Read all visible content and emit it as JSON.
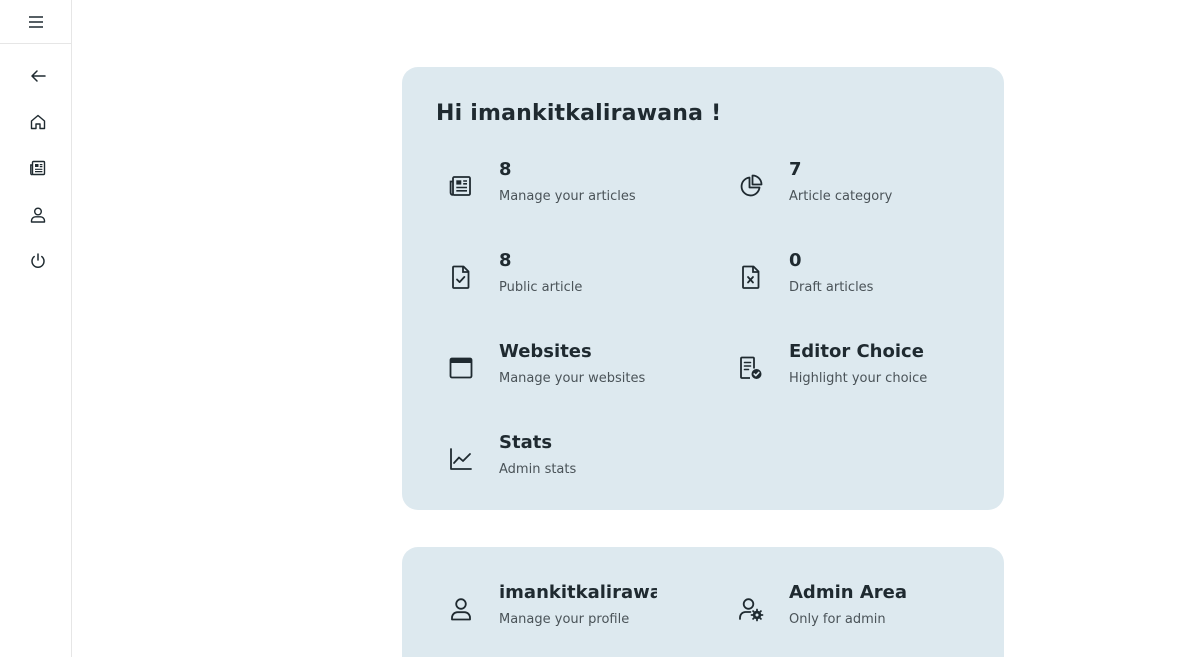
{
  "sidebar": {
    "menu_icon": "hamburger-icon",
    "items": [
      {
        "icon": "arrow-left-icon"
      },
      {
        "icon": "home-icon"
      },
      {
        "icon": "newspaper-icon"
      },
      {
        "icon": "user-icon"
      },
      {
        "icon": "power-icon"
      }
    ]
  },
  "dashboard": {
    "greeting": "Hi imankitkalirawana !",
    "tiles": [
      {
        "value": "8",
        "label": "Manage your articles",
        "icon": "newspaper-icon"
      },
      {
        "value": "7",
        "label": "Article category",
        "icon": "pie-chart-icon"
      },
      {
        "value": "8",
        "label": "Public article",
        "icon": "file-check-icon"
      },
      {
        "value": "0",
        "label": "Draft articles",
        "icon": "file-x-icon"
      },
      {
        "value": "Websites",
        "label": "Manage your websites",
        "icon": "browser-window-icon"
      },
      {
        "value": "Editor Choice",
        "label": "Highlight your choice",
        "icon": "document-badge-check-icon"
      },
      {
        "value": "Stats",
        "label": "Admin stats",
        "icon": "line-chart-icon"
      }
    ]
  },
  "account": {
    "tiles": [
      {
        "value": "imankitkalirawana",
        "label": "Manage your profile",
        "icon": "user-icon"
      },
      {
        "value": "Admin Area",
        "label": "Only for admin",
        "icon": "user-gear-icon"
      }
    ]
  },
  "colors": {
    "card_bg": "#dde9ef",
    "text_primary": "#1f2a30",
    "text_secondary": "#4a5358"
  }
}
